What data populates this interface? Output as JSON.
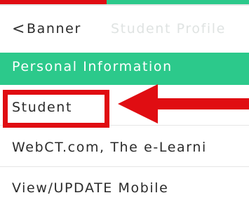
{
  "colors": {
    "accent_green": "#2cc98b",
    "highlight_red": "#e00d12"
  },
  "header": {
    "back_icon": "chevron-left-icon",
    "back_glyph": "<",
    "title": "Banner",
    "ghost_title": "Student Profile"
  },
  "section": {
    "title": "Personal Information"
  },
  "items": [
    {
      "label": "Student"
    },
    {
      "label": "WebCT.com, The e-Learni"
    },
    {
      "label": "View/UPDATE Mobile"
    }
  ],
  "annotation": {
    "type": "arrow-callout",
    "target": "Student"
  }
}
